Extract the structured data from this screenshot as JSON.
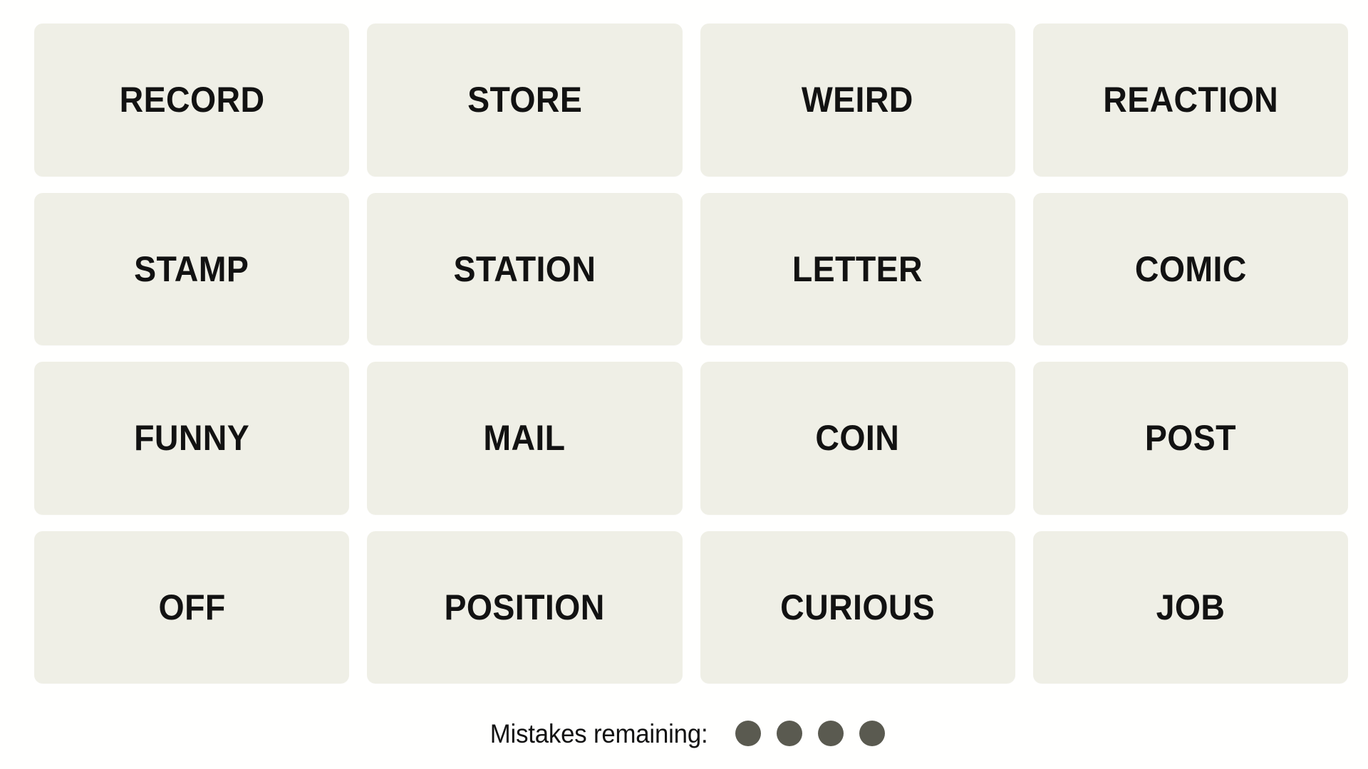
{
  "app": {
    "name": "Connections",
    "background_color": "#fffffe"
  },
  "grid": {
    "rows": 4,
    "columns": 4,
    "tile_color": "#efefe6",
    "tile_text_color": "#121212",
    "tiles": [
      {
        "label": "RECORD",
        "row": 1,
        "column": 1,
        "selected": false
      },
      {
        "label": "STORE",
        "row": 1,
        "column": 2,
        "selected": false
      },
      {
        "label": "WEIRD",
        "row": 1,
        "column": 3,
        "selected": false
      },
      {
        "label": "REACTION",
        "row": 1,
        "column": 4,
        "selected": false
      },
      {
        "label": "STAMP",
        "row": 2,
        "column": 1,
        "selected": false
      },
      {
        "label": "STATION",
        "row": 2,
        "column": 2,
        "selected": false
      },
      {
        "label": "LETTER",
        "row": 2,
        "column": 3,
        "selected": false
      },
      {
        "label": "COMIC",
        "row": 2,
        "column": 4,
        "selected": false
      },
      {
        "label": "FUNNY",
        "row": 3,
        "column": 1,
        "selected": false
      },
      {
        "label": "MAIL",
        "row": 3,
        "column": 2,
        "selected": false
      },
      {
        "label": "COIN",
        "row": 3,
        "column": 3,
        "selected": false
      },
      {
        "label": "POST",
        "row": 3,
        "column": 4,
        "selected": false
      },
      {
        "label": "OFF",
        "row": 4,
        "column": 1,
        "selected": false
      },
      {
        "label": "POSITION",
        "row": 4,
        "column": 2,
        "selected": false
      },
      {
        "label": "CURIOUS",
        "row": 4,
        "column": 3,
        "selected": false
      },
      {
        "label": "JOB",
        "row": 4,
        "column": 4,
        "selected": false
      }
    ]
  },
  "mistakes": {
    "label": "Mistakes remaining:",
    "remaining": 4,
    "dot_color": "#5a5a50",
    "dots": [
      {
        "icon": "filled-circle-icon",
        "used": false
      },
      {
        "icon": "filled-circle-icon",
        "used": false
      },
      {
        "icon": "filled-circle-icon",
        "used": false
      },
      {
        "icon": "filled-circle-icon",
        "used": false
      }
    ]
  }
}
